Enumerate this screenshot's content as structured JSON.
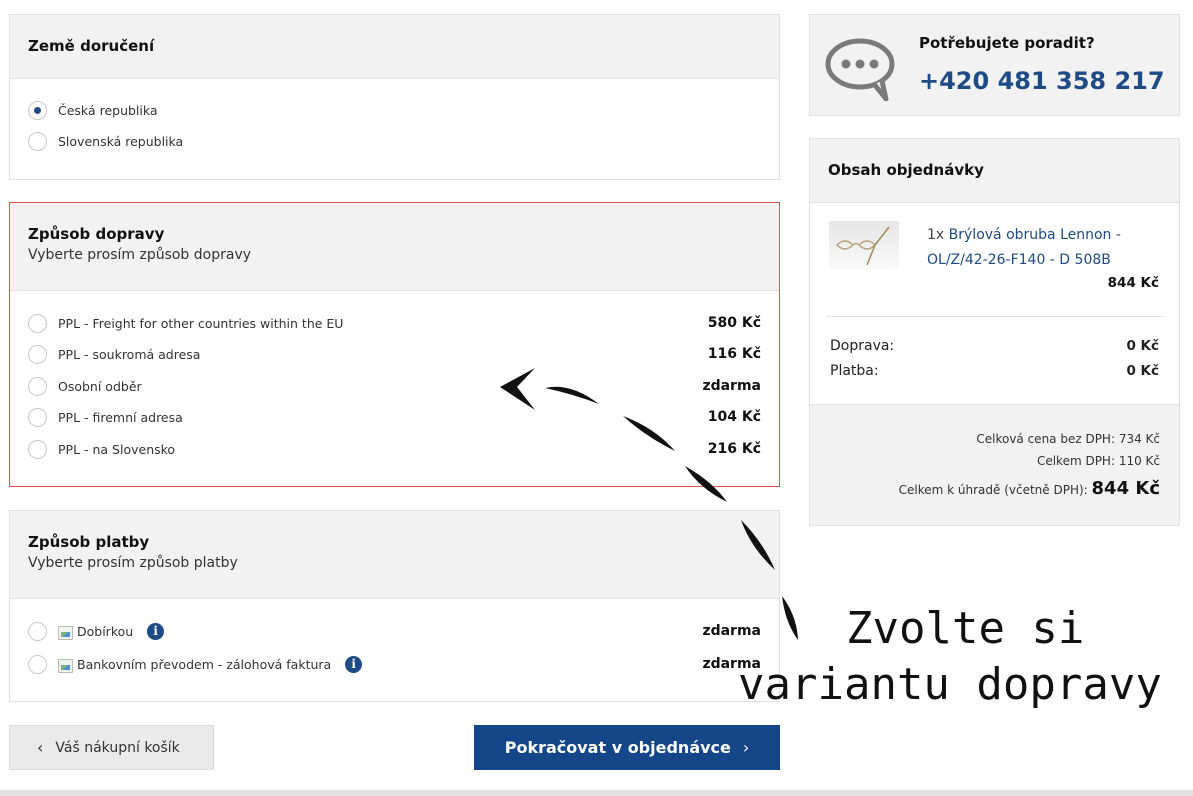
{
  "delivery_country": {
    "title": "Země doručení",
    "options": [
      {
        "label": "Česká republika",
        "checked": true
      },
      {
        "label": "Slovenská republika",
        "checked": false
      }
    ]
  },
  "shipping": {
    "title": "Způsob dopravy",
    "subtitle": "Vyberte prosím způsob dopravy",
    "options": [
      {
        "label": "PPL - Freight for other countries within the EU",
        "price": "580 Kč"
      },
      {
        "label": "PPL - soukromá adresa",
        "price": "116 Kč"
      },
      {
        "label": "Osobní odběr",
        "price": "zdarma"
      },
      {
        "label": "PPL - firemní adresa",
        "price": "104 Kč"
      },
      {
        "label": "PPL - na Slovensko",
        "price": "216 Kč"
      }
    ],
    "error_border_color": "#d9534f"
  },
  "payment": {
    "title": "Způsob platby",
    "subtitle": "Vyberte prosím způsob platby",
    "options": [
      {
        "label": "Dobírkou",
        "price": "zdarma",
        "icon": "info-icon"
      },
      {
        "label": "Bankovním převodem - zálohová faktura",
        "price": "zdarma",
        "icon": "info-icon"
      }
    ]
  },
  "buttons": {
    "back": "Váš nákupní košík",
    "next": "Pokračovat v objednávce"
  },
  "help": {
    "question": "Potřebujete poradit?",
    "phone": "+420 481 358 217",
    "icon": "chat-bubble-icon"
  },
  "order": {
    "title": "Obsah objednávky",
    "item": {
      "qty": "1x",
      "name": "Brýlová obruba Lennon - OL/Z/42-26-F140 - D 508B",
      "price": "844 Kč"
    },
    "shipping_label": "Doprava:",
    "shipping_value": "0 Kč",
    "payment_label": "Platba:",
    "payment_value": "0 Kč",
    "total_no_vat": "Celková cena bez DPH: 734 Kč",
    "vat_total": "Celkem DPH: 110 Kč",
    "total_label": "Celkem k úhradě (včetně DPH):",
    "total_value": "844 Kč"
  },
  "annotation": {
    "line1": "Zvolte si",
    "line2": "variantu dopravy"
  },
  "colors": {
    "accent": "#1e4a86",
    "button_primary": "#15468a",
    "panel_bg": "#f2f2f2"
  }
}
